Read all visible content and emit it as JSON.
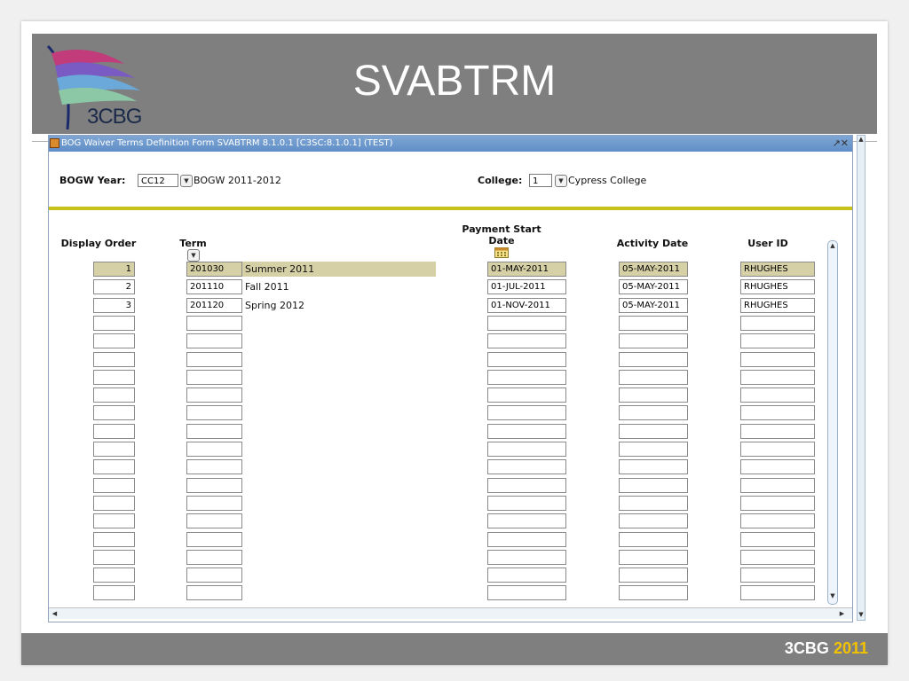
{
  "slide": {
    "title": "SVABTRM",
    "logo_text": "3CBG",
    "footer_brand": "3CBG",
    "footer_year": "2011"
  },
  "window": {
    "title": "BOG Waiver Terms Definition Form  SVABTRM  8.1.0.1  [C3SC:8.1.0.1]  (TEST)",
    "controls": "↗✕"
  },
  "key_block": {
    "bogw_year_label": "BOGW Year:",
    "bogw_year_value": "CC12",
    "bogw_year_desc": "BOGW 2011-2012",
    "college_label": "College:",
    "college_value": "1",
    "college_desc": "Cypress College"
  },
  "columns": {
    "display_order": "Display Order",
    "term": "Term",
    "payment_start": "Payment Start",
    "payment_start_2": "Date",
    "activity_date": "Activity Date",
    "user_id": "User ID"
  },
  "rows": [
    {
      "order": "1",
      "term": "201030",
      "term_desc": "Summer 2011",
      "payment_start": "01-MAY-2011",
      "activity_date": "05-MAY-2011",
      "user_id": "RHUGHES"
    },
    {
      "order": "2",
      "term": "201110",
      "term_desc": "Fall 2011",
      "payment_start": "01-JUL-2011",
      "activity_date": "05-MAY-2011",
      "user_id": "RHUGHES"
    },
    {
      "order": "3",
      "term": "201120",
      "term_desc": "Spring 2012",
      "payment_start": "01-NOV-2011",
      "activity_date": "05-MAY-2011",
      "user_id": "RHUGHES"
    }
  ],
  "empty_rows": 16,
  "icons": {
    "term_dropdown": "dropdown-arrow-icon",
    "calendar": "calendar-icon",
    "window": "app-window-icon"
  },
  "colors": {
    "slide_band": "#7f7f7f",
    "window_title": "#5f8ec7",
    "separator": "#c9c21a",
    "selected_row": "#d6d0a6",
    "footer_year": "#f2c200"
  }
}
